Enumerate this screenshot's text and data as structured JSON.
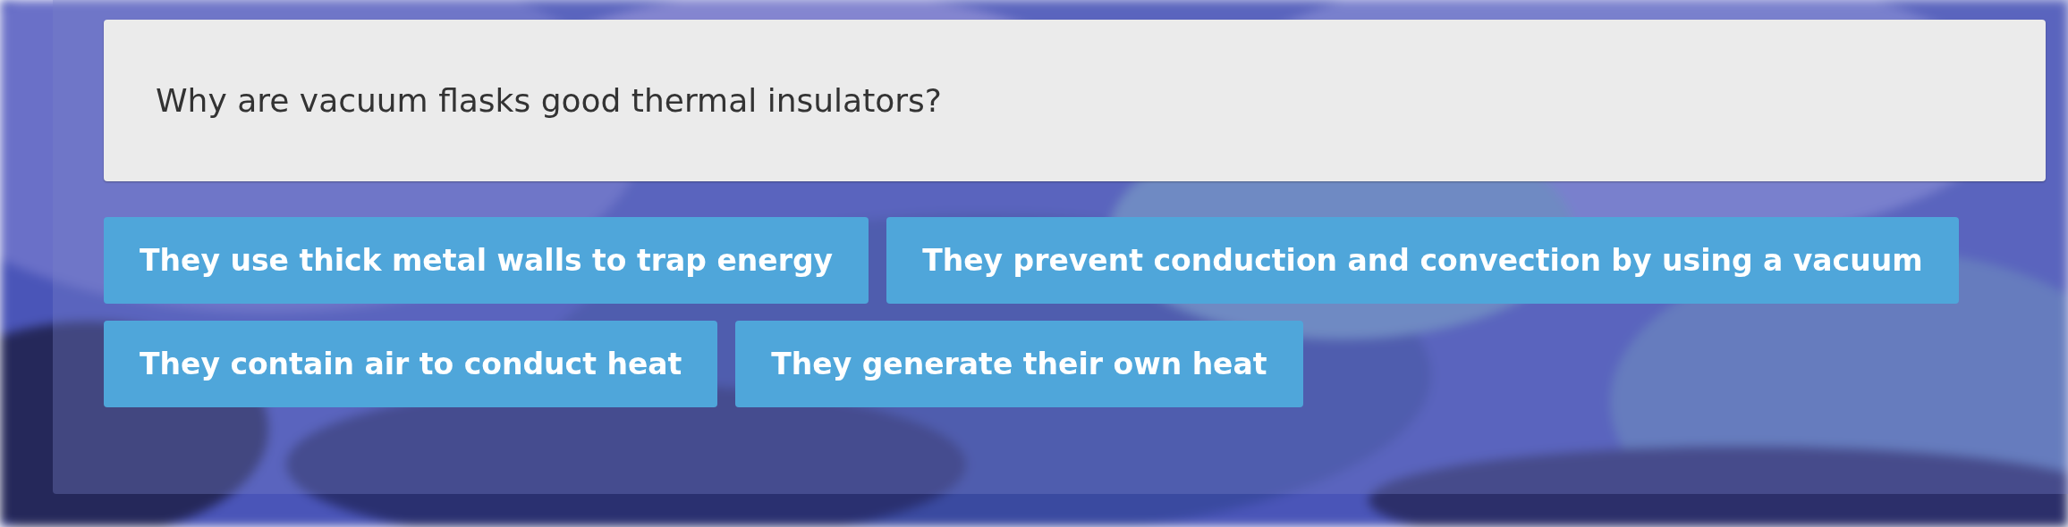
{
  "question": {
    "text": "Why are vacuum flasks good thermal insulators?"
  },
  "answers": [
    {
      "label": "They use thick metal walls to trap energy"
    },
    {
      "label": "They prevent conduction and convection by using a vacuum"
    },
    {
      "label": "They contain air to conduct heat"
    },
    {
      "label": "They generate their own heat"
    }
  ]
}
